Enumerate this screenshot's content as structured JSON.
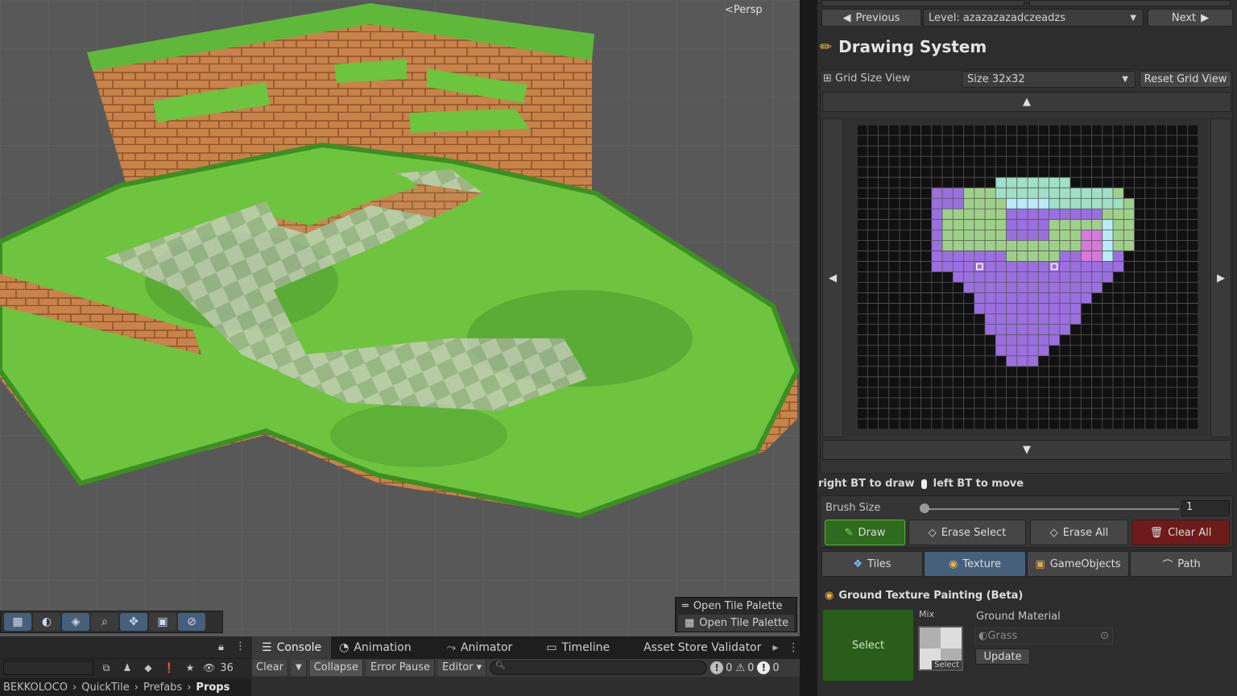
{
  "scene": {
    "camera_label": "Persp",
    "open_tile_palette": [
      "Open Tile Palette",
      "Open Tile Palette"
    ]
  },
  "scene_toolbar": {
    "icons": [
      "grid-toggle-icon",
      "globe-icon",
      "layers-icon",
      "zoom-icon",
      "move-icon",
      "camera-icon",
      "compass-icon"
    ]
  },
  "hierarchy": {
    "visible_count": "36",
    "breadcrumbs": [
      "BEKKOLOCO",
      "QuickTile",
      "Prefabs",
      "Props"
    ]
  },
  "bottom_tabs": [
    "Console",
    "Animation",
    "Animator",
    "Timeline",
    "Asset Store Validator"
  ],
  "console": {
    "clear": "Clear",
    "collapse": "Collapse",
    "error_pause": "Error Pause",
    "editor": "Editor",
    "info_count": "0",
    "warn_count": "0",
    "error_count": "0"
  },
  "nav": {
    "previous": "Previous",
    "level": "Level: azazazazadczeadzs",
    "next": "Next"
  },
  "drawing": {
    "title": "Drawing System",
    "grid_size_view": "Grid Size View",
    "size_option": "Size 32x32",
    "reset_grid_view": "Reset Grid View",
    "hint_draw": "right BT to draw",
    "hint_move": "left BT to move",
    "brush_size_label": "Brush Size",
    "brush_size_value": "1",
    "brush_fraction": 0.0,
    "draw": "Draw",
    "erase_select": "Erase Select",
    "erase_all": "Erase All",
    "clear_all": "Clear All",
    "tabs": [
      "Tiles",
      "Texture",
      "GameObjects",
      "Path"
    ],
    "active_tab": "Texture",
    "texture_section": "Ground Texture Painting (Beta)",
    "select": "Select",
    "mix": "Mix",
    "mix_select": "Select",
    "ground_material_label": "Ground Material",
    "ground_material": "Grass",
    "update": "Update"
  },
  "colors": {
    "draw_green": "#2e6b1f",
    "clear_red": "#6e1a1a",
    "tab_active": "#46607c",
    "purple": "#9b6fe0",
    "green_tile": "#9fd08a",
    "mint_tile": "#9fe0c8",
    "cyan_tile": "#b8ecf8",
    "pink_tile": "#d57ad8"
  }
}
